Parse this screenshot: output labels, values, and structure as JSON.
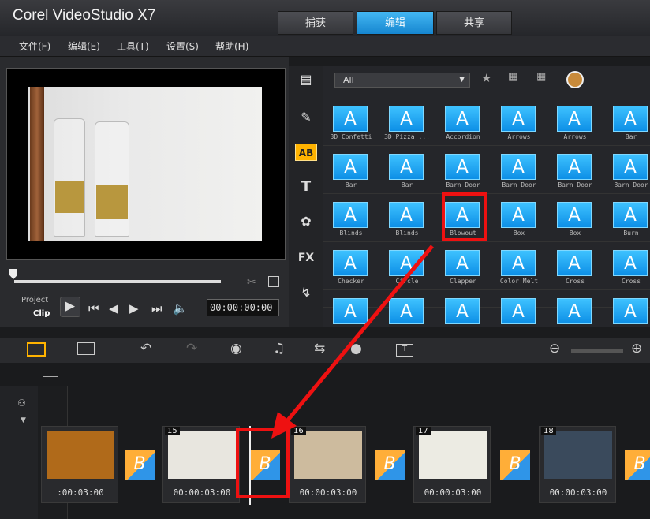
{
  "app": {
    "title": "Corel VideoStudio X7"
  },
  "tabs": [
    {
      "label": "捕获"
    },
    {
      "label": "编辑"
    },
    {
      "label": "共享"
    }
  ],
  "menu": [
    {
      "label": "文件(F)"
    },
    {
      "label": "编辑(E)"
    },
    {
      "label": "工具(T)"
    },
    {
      "label": "设置(S)"
    },
    {
      "label": "帮助(H)"
    }
  ],
  "preview": {
    "mode_project": "Project",
    "mode_clip": "Clip",
    "timecode": "00:00:00:00"
  },
  "library": {
    "filter": "All",
    "thumb_glyph": "A",
    "transitions": [
      "3D Confetti",
      "3D Pizza ...",
      "Accordion",
      "Arrows",
      "Arrows",
      "Bar",
      "Bar",
      "Bar",
      "Barn Door",
      "Barn Door",
      "Barn Door",
      "Barn Door",
      "Blinds",
      "Blinds",
      "Blowout",
      "Box",
      "Box",
      "Burn",
      "Checker",
      "Circle",
      "Clapper",
      "Color Melt",
      "Cross",
      "Cross"
    ],
    "selected": "Blowout"
  },
  "timeline": {
    "transition_glyph": "B",
    "clips": [
      {
        "number": "",
        "duration": ":00:03:00",
        "color": "#b06a1a"
      },
      {
        "number": "15",
        "duration": "00:00:03:00",
        "color": "#e8e6df"
      },
      {
        "number": "16",
        "duration": "00:00:03:00",
        "color": "#cdbb9e"
      },
      {
        "number": "17",
        "duration": "00:00:03:00",
        "color": "#ecebe3"
      },
      {
        "number": "18",
        "duration": "00:00:03:00",
        "color": "#3a4a5c"
      }
    ]
  },
  "colors": {
    "accent_blue": "#1e9be6",
    "highlight_red": "#e11111",
    "transition_orange": "#ffae38"
  }
}
